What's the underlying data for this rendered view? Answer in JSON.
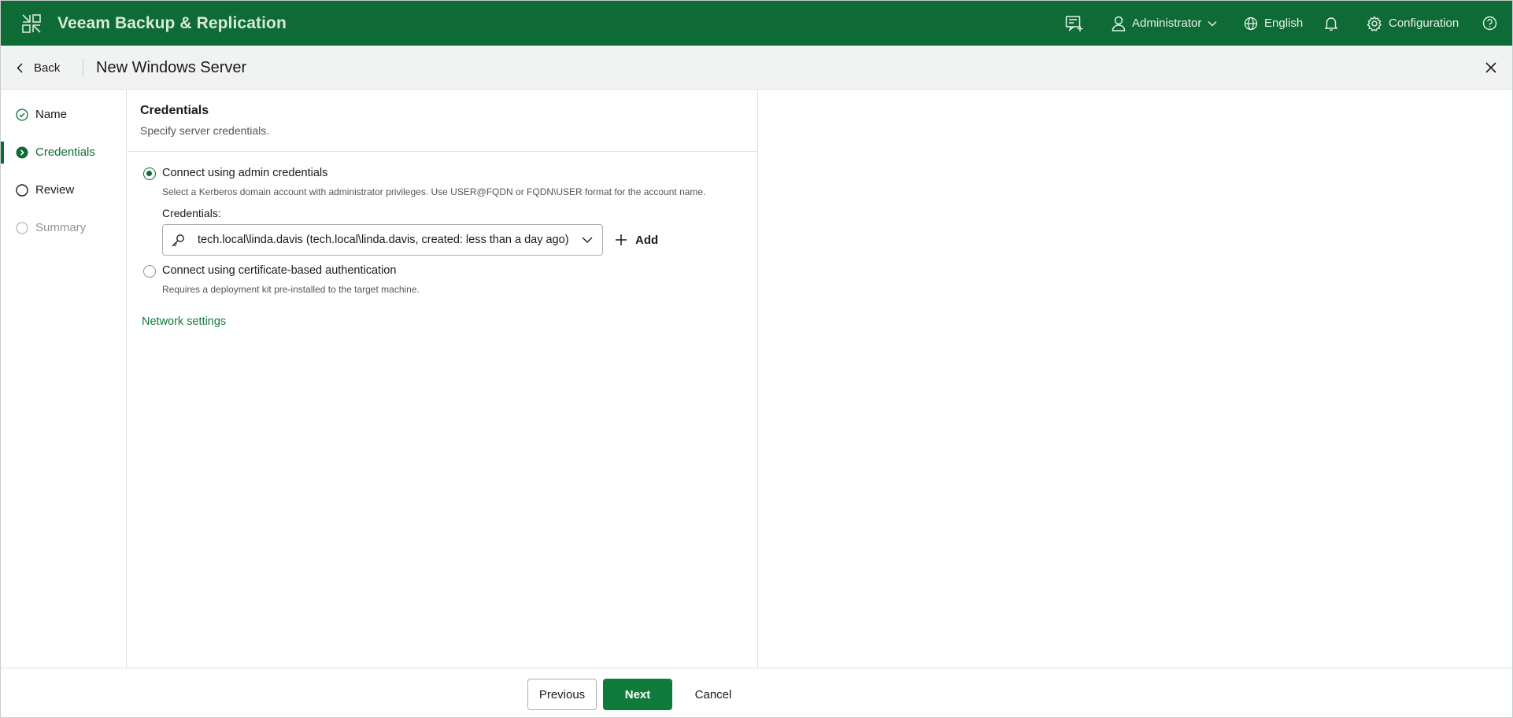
{
  "app": {
    "title": "Veeam Backup & Replication"
  },
  "topbar": {
    "tasks_icon": "tasks-icon",
    "user_label": "Administrator",
    "language_label": "English",
    "notifications_icon": "bell-icon",
    "config_label": "Configuration",
    "help_icon": "help-icon"
  },
  "titlebar": {
    "back_label": "Back",
    "title": "New Windows Server"
  },
  "steps": [
    {
      "label": "Name",
      "state": "completed"
    },
    {
      "label": "Credentials",
      "state": "active"
    },
    {
      "label": "Review",
      "state": "pending"
    },
    {
      "label": "Summary",
      "state": "disabled"
    }
  ],
  "section": {
    "title": "Credentials",
    "subtitle": "Specify server credentials."
  },
  "options": {
    "admin": {
      "label": "Connect using admin credentials",
      "help": "Select a Kerberos domain account with administrator privileges. Use USER@FQDN or FQDN\\USER format for the account name.",
      "checked": true
    },
    "cert": {
      "label": "Connect using certificate-based authentication",
      "help": "Requires a deployment kit pre-installed to the target machine.",
      "checked": false
    }
  },
  "credentials": {
    "label": "Credentials:",
    "value": "tech.local\\linda.davis  (tech.local\\linda.davis, created: less than a day ago)",
    "add_label": "Add"
  },
  "network_link": "Network settings",
  "footer": {
    "previous_label": "Previous",
    "next_label": "Next",
    "cancel_label": "Cancel"
  },
  "colors": {
    "brand": "#0f6b35",
    "link": "#0f7a3a",
    "primary_button": "#0f7a3a"
  }
}
